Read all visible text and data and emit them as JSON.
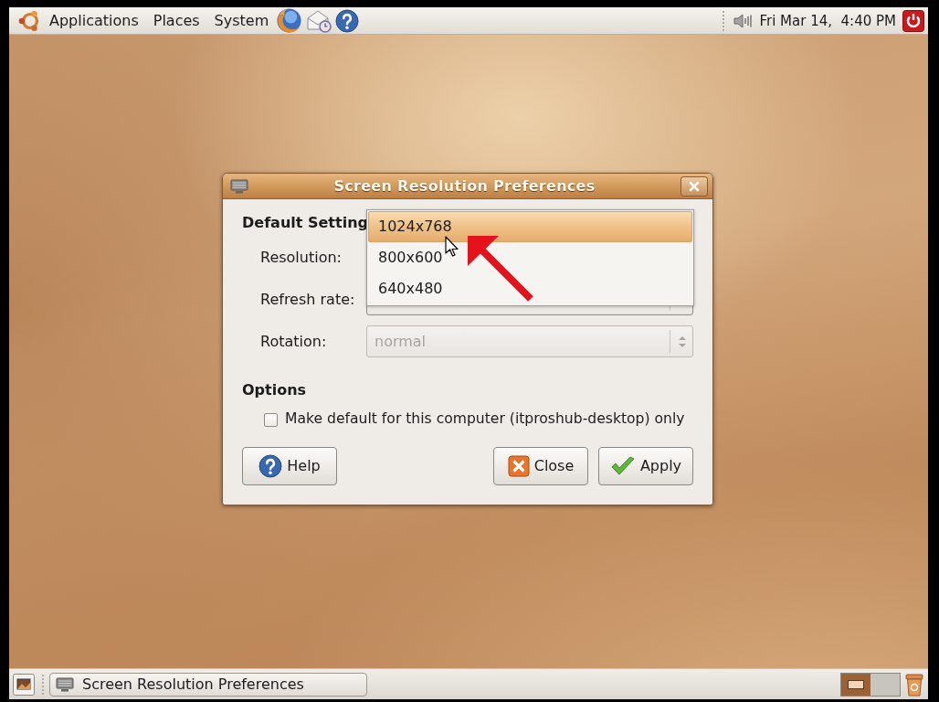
{
  "top_panel": {
    "menus": [
      "Applications",
      "Places",
      "System"
    ],
    "clock": "Fri Mar 14,  4:40 PM"
  },
  "dialog": {
    "title": "Screen Resolution Preferences",
    "section_heading": "Default Setting",
    "fields": [
      {
        "label": "Resolution:"
      },
      {
        "label": "Refresh rate:",
        "combo": {
          "disabled": false
        }
      },
      {
        "label": "Rotation:",
        "combo": {
          "value": "normal",
          "disabled": true
        }
      }
    ],
    "options_heading": "Options",
    "checkbox": {
      "label": "Make default for this computer (itproshub-desktop) only",
      "checked": false
    },
    "buttons": [
      {
        "kind": "help",
        "label": "Help"
      },
      {
        "kind": "close",
        "label": "Close"
      },
      {
        "kind": "apply",
        "label": "Apply"
      }
    ],
    "dropdown": {
      "options": [
        {
          "label": "1024x768",
          "selected": true
        },
        {
          "label": "800x600",
          "selected": false
        },
        {
          "label": "640x480",
          "selected": false
        }
      ]
    }
  },
  "bottom_panel": {
    "window_list": [
      {
        "label": "Screen Resolution Preferences"
      }
    ],
    "workspaces": [
      {
        "selected": true
      },
      {
        "selected": false
      }
    ]
  }
}
